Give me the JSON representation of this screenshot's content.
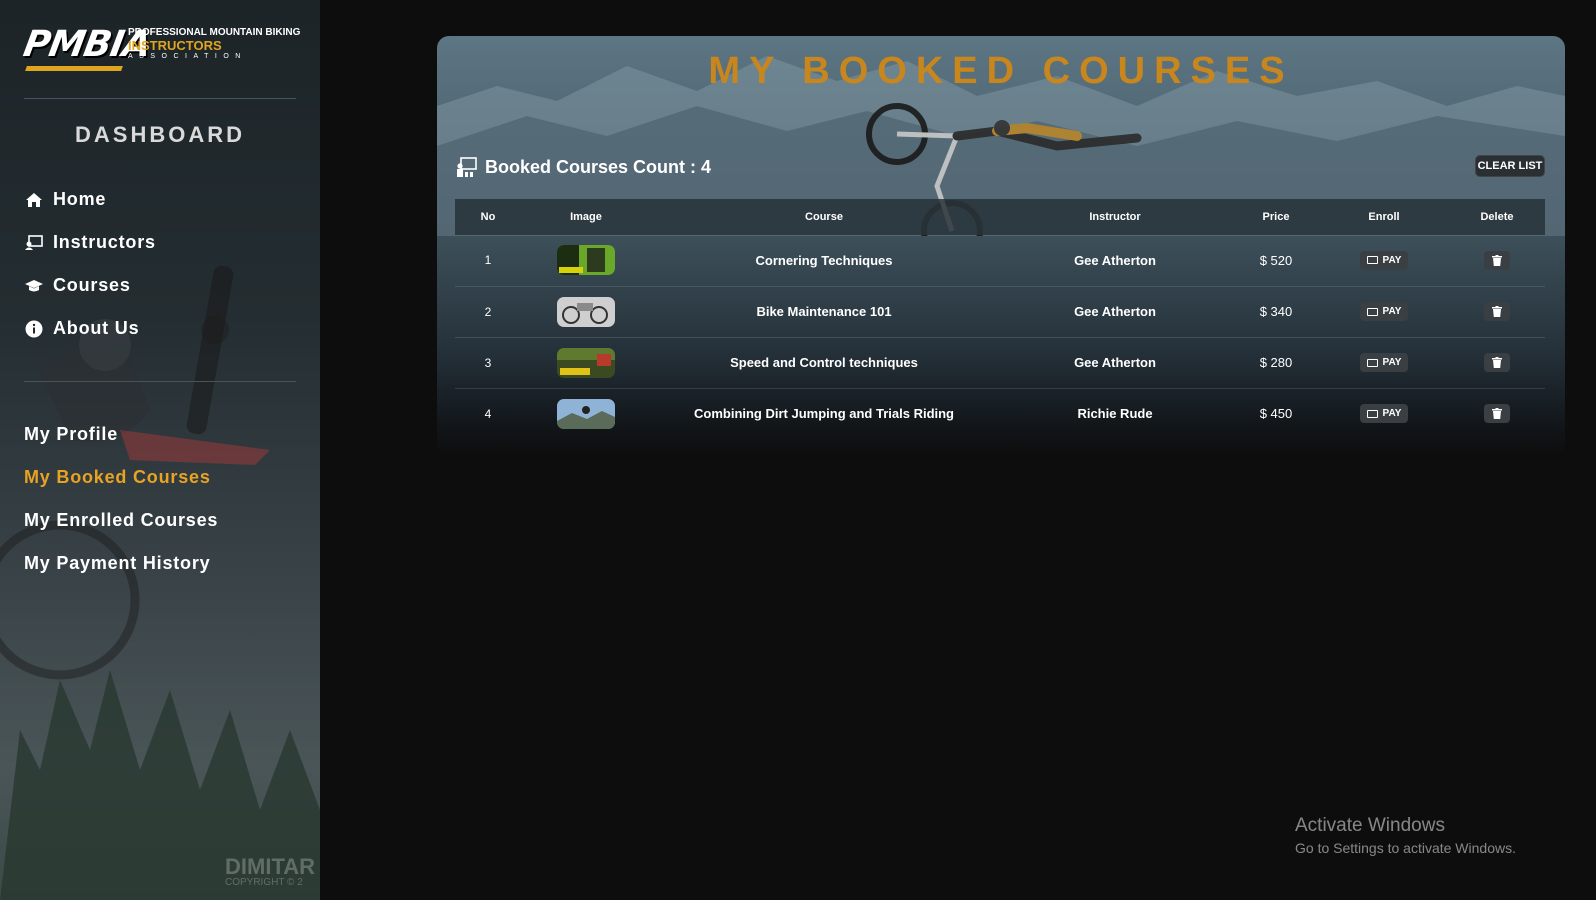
{
  "brand": {
    "logo_text": "PMBIA",
    "line1": "PROFESSIONAL MOUNTAIN BIKING",
    "line2": "INSTRUCTORS",
    "line3": "ASSOCIATION"
  },
  "sidebar": {
    "title": "DASHBOARD",
    "main_items": [
      {
        "label": "Home",
        "icon": "home-icon"
      },
      {
        "label": "Instructors",
        "icon": "instructor-icon"
      },
      {
        "label": "Courses",
        "icon": "graduation-cap-icon"
      },
      {
        "label": "About Us",
        "icon": "info-icon"
      }
    ],
    "user_items": [
      {
        "label": "My Profile",
        "active": false
      },
      {
        "label": "My Booked Courses",
        "active": true
      },
      {
        "label": "My Enrolled Courses",
        "active": false
      },
      {
        "label": "My Payment History",
        "active": false
      }
    ],
    "watermark": "DIMITAR",
    "watermark_sub": "COPYRIGHT © 2"
  },
  "main": {
    "title": "MY BOOKED COURSES",
    "count_label": "Booked Courses Count : 4",
    "clear_label": "CLEAR LIST",
    "columns": [
      "No",
      "Image",
      "Course",
      "Instructor",
      "Price",
      "Enroll",
      "Delete"
    ],
    "pay_label": "PAY",
    "rows": [
      {
        "no": "1",
        "course": "Cornering Techniques",
        "instructor": "Gee Atherton",
        "price": "$ 520"
      },
      {
        "no": "2",
        "course": "Bike Maintenance 101",
        "instructor": "Gee Atherton",
        "price": "$ 340"
      },
      {
        "no": "3",
        "course": "Speed and Control techniques",
        "instructor": "Gee Atherton",
        "price": "$ 280"
      },
      {
        "no": "4",
        "course": "Combining Dirt Jumping and Trials Riding",
        "instructor": "Richie Rude",
        "price": "$ 450"
      }
    ]
  },
  "os_notice": {
    "title": "Activate Windows",
    "subtitle": "Go to Settings to activate Windows."
  },
  "colors": {
    "accent": "#e8a322",
    "title_gold": "#c8861c"
  }
}
